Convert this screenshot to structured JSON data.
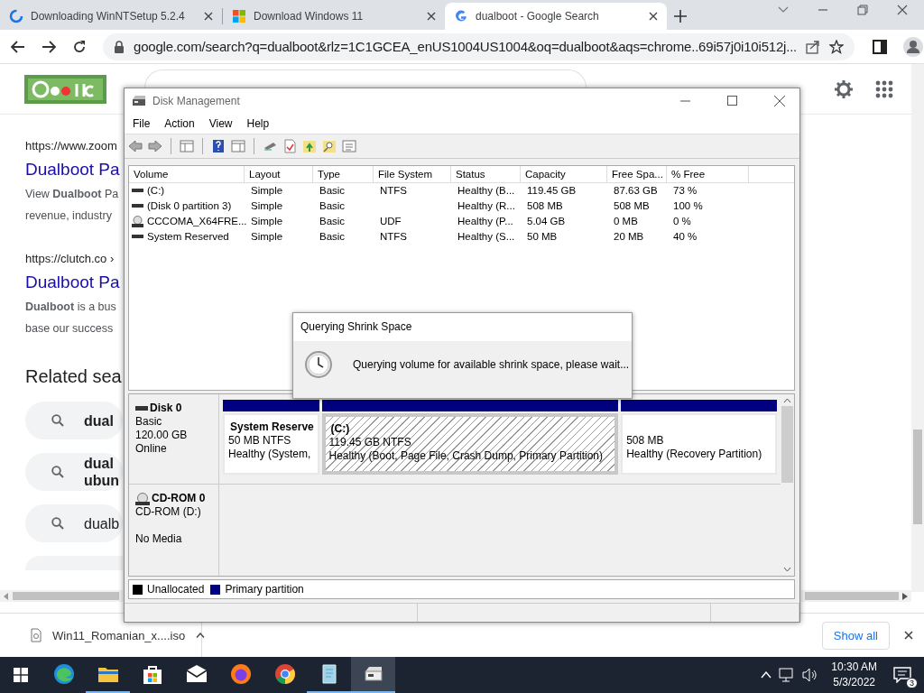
{
  "browser": {
    "tabs": [
      {
        "title": "Downloading WinNTSetup 5.2.4",
        "kind": "loading",
        "selected": false
      },
      {
        "title": "Download Windows 11",
        "kind": "windows",
        "selected": false
      },
      {
        "title": "dualboot - Google Search",
        "kind": "google",
        "selected": true
      }
    ],
    "address": "google.com/search?q=dualboot&rlz=1C1GCEA_enUS1004US1004&oq=dualboot&aqs=chrome..69i57j0i10i512j...",
    "results": [
      {
        "url": "https://www.zoom",
        "title": "Dualboot Pa",
        "snippet": [
          "View **Dualboot** Pa",
          "revenue, industry"
        ]
      },
      {
        "url": "https://clutch.co ›",
        "title": "Dualboot Pa",
        "snippet": [
          "**Dualboot** is a bus",
          "base our success"
        ]
      }
    ],
    "related": {
      "heading": "Related sea",
      "items": [
        {
          "lines": [
            "dual"
          ],
          "bold": true
        },
        {
          "lines": [
            "dual",
            "ubun"
          ],
          "bold": true
        },
        {
          "lines": [
            "dualb"
          ],
          "bold": false
        }
      ]
    },
    "downloads": {
      "file": "Win11_Romanian_x....iso",
      "show_all": "Show all"
    }
  },
  "disk_management": {
    "title": "Disk Management",
    "menu": [
      "File",
      "Action",
      "View",
      "Help"
    ],
    "columns": [
      "Volume",
      "Layout",
      "Type",
      "File System",
      "Status",
      "Capacity",
      "Free Spa...",
      "% Free"
    ],
    "rows": [
      {
        "kind": "disk",
        "cells": [
          "(C:)",
          "Simple",
          "Basic",
          "NTFS",
          "Healthy (B...",
          "119.45 GB",
          "87.63 GB",
          "73 %"
        ]
      },
      {
        "kind": "disk",
        "cells": [
          "(Disk 0 partition 3)",
          "Simple",
          "Basic",
          null,
          "Healthy (R...",
          "508 MB",
          "508 MB",
          "100 %"
        ]
      },
      {
        "kind": "cd",
        "cells": [
          "CCCOMA_X64FRE...",
          "Simple",
          "Basic",
          "UDF",
          "Healthy (P...",
          "5.04 GB",
          "0 MB",
          "0 %"
        ]
      },
      {
        "kind": "disk",
        "cells": [
          "System Reserved",
          "Simple",
          "Basic",
          "NTFS",
          "Healthy (S...",
          "50 MB",
          "20 MB",
          "40 %"
        ]
      }
    ],
    "disks": [
      {
        "kind": "disk",
        "name": "Disk 0",
        "lines": [
          "Basic",
          "120.00 GB",
          "Online"
        ],
        "partitions": [
          {
            "name": "System Reserve",
            "lines": [
              "50 MB NTFS",
              "Healthy (System,"
            ],
            "selected": false
          },
          {
            "name": "(C:)",
            "lines": [
              "119.45 GB NTFS",
              "Healthy (Boot, Page File, Crash Dump, Primary Partition)"
            ],
            "selected": true
          },
          {
            "lines": [
              "508 MB",
              "Healthy (Recovery Partition)"
            ],
            "selected": false
          }
        ]
      },
      {
        "kind": "cd",
        "name": "CD-ROM 0",
        "lines": [
          "CD-ROM (D:)",
          "No Media"
        ]
      }
    ],
    "legend": [
      {
        "label": "Unallocated",
        "color": "#000000"
      },
      {
        "label": "Primary partition",
        "color": "#000080"
      }
    ]
  },
  "dialog": {
    "title": "Querying Shrink Space",
    "message": "Querying volume for available shrink space, please wait..."
  },
  "taskbar": {
    "apps": [
      {
        "kind": "edge",
        "running": false,
        "selected": false
      },
      {
        "kind": "explorer",
        "running": true,
        "selected": false
      },
      {
        "kind": "store",
        "running": false,
        "selected": false
      },
      {
        "kind": "mail",
        "running": false,
        "selected": false
      },
      {
        "kind": "firefox",
        "running": false,
        "selected": false
      },
      {
        "kind": "chrome",
        "running": false,
        "selected": false
      },
      {
        "kind": "notepad",
        "running": true,
        "selected": false
      },
      {
        "kind": "diskmgmt",
        "running": true,
        "selected": true
      }
    ],
    "time": "10:30 AM",
    "date": "5/3/2022",
    "notifications": "3"
  }
}
